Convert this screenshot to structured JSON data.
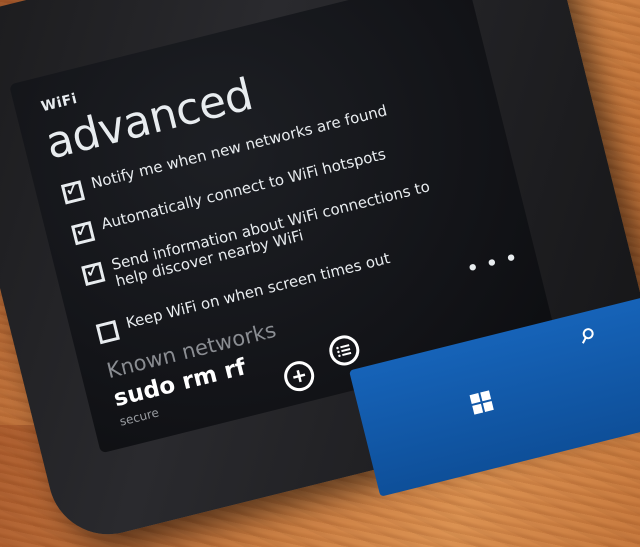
{
  "screen": {
    "app_title": "WiFi",
    "page_title": "advanced"
  },
  "options": [
    {
      "label": "Notify me when new networks are found",
      "checked": true
    },
    {
      "label": "Automatically connect to WiFi hotspots",
      "checked": true
    },
    {
      "label": "Send information about WiFi connections to help discover nearby WiFi",
      "checked": true
    },
    {
      "label": "Keep WiFi on when screen times out",
      "checked": false
    }
  ],
  "known_networks": {
    "title": "Known networks",
    "items": [
      {
        "name": "sudo rm rf",
        "status": "secure"
      }
    ]
  },
  "app_bar": {
    "add_icon": "add-icon",
    "list_icon": "list-icon",
    "more_icon": "more-icon"
  },
  "hardware_buttons": {
    "windows_icon": "windows-icon",
    "search_icon": "search-icon"
  },
  "colors": {
    "screen_bg": "#121317",
    "text": "#e8ecef",
    "nav_blue": "#1663b8"
  }
}
